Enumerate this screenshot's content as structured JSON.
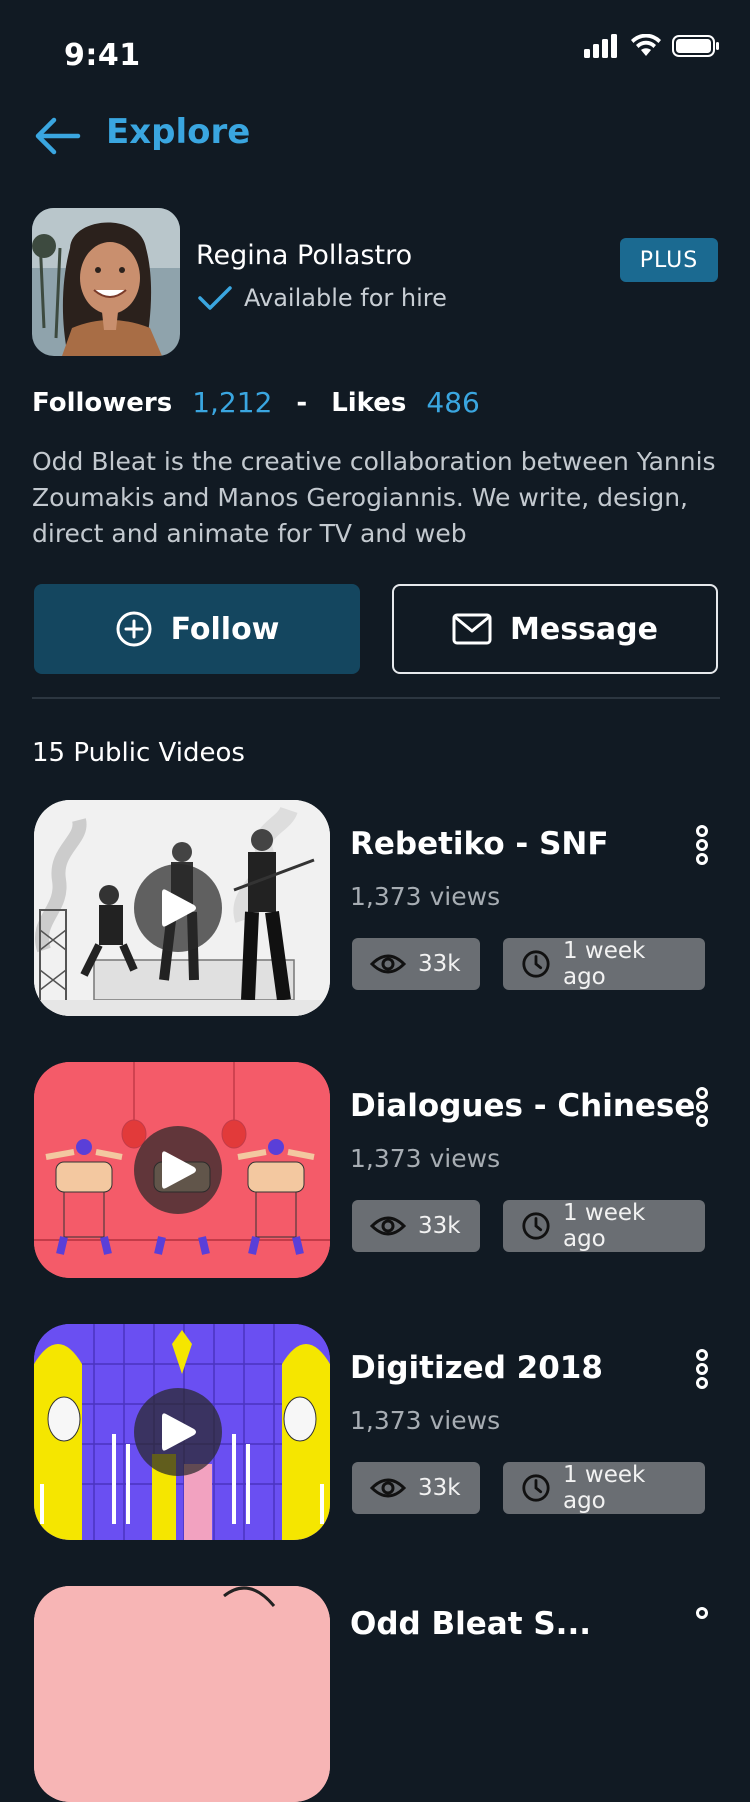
{
  "status_bar": {
    "time": "9:41"
  },
  "nav": {
    "title": "Explore"
  },
  "profile": {
    "name": "Regina Pollastro",
    "availability": "Available for hire",
    "badge": "PLUS",
    "followers_label": "Followers",
    "followers_value": "1,212",
    "separator": "-",
    "likes_label": "Likes",
    "likes_value": "486",
    "bio": "Odd Bleat is the creative collaboration between Yannis Zoumakis and Manos Gerogiannis. We write, design, direct and animate for TV and web"
  },
  "actions": {
    "follow_label": "Follow",
    "message_label": "Message"
  },
  "videos_heading": "15 Public Videos",
  "videos": [
    {
      "title": "Rebetiko - SNF",
      "views": "1,373 views",
      "view_count": "33k",
      "age": "1 week ago"
    },
    {
      "title": "Dialogues - Chinese",
      "views": "1,373 views",
      "view_count": "33k",
      "age": "1 week ago"
    },
    {
      "title": "Digitized 2018",
      "views": "1,373 views",
      "view_count": "33k",
      "age": "1 week ago"
    },
    {
      "title": "Odd Bleat S...",
      "views": "",
      "view_count": "",
      "age": ""
    }
  ],
  "colors": {
    "background": "#111a23",
    "accent": "#3aa6e0",
    "follow_button": "#14465f",
    "badge": "#1b6a91",
    "chip": "#6a6e73"
  }
}
